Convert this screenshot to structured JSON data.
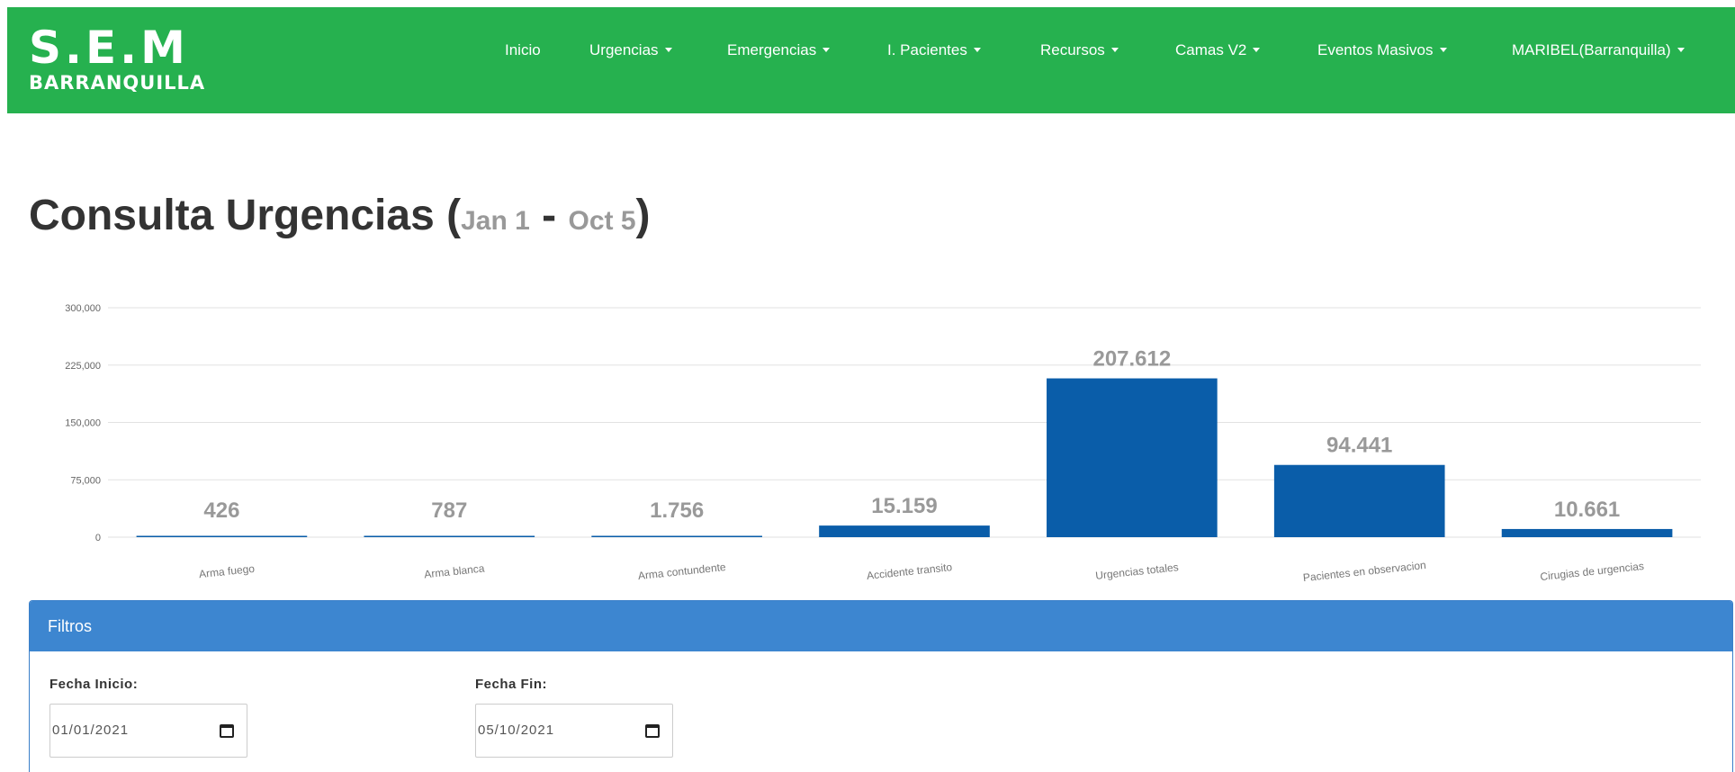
{
  "brand": {
    "line1": "S.E.M",
    "line2": "BARRANQUILLA"
  },
  "nav": {
    "items": [
      {
        "label": "Inicio",
        "dropdown": false
      },
      {
        "label": "Urgencias",
        "dropdown": true
      },
      {
        "label": "Emergencias",
        "dropdown": true
      },
      {
        "label": "I. Pacientes",
        "dropdown": true
      },
      {
        "label": "Recursos",
        "dropdown": true
      },
      {
        "label": "Camas V2",
        "dropdown": true
      },
      {
        "label": "Eventos Masivos",
        "dropdown": true
      },
      {
        "label": "MARIBEL(Barranquilla)",
        "dropdown": true
      }
    ]
  },
  "page": {
    "title": "Consulta Urgencias",
    "open_paren": "(",
    "range_start": "Jan 1",
    "range_sep": " - ",
    "range_end": "Oct 5",
    "close_paren": ")"
  },
  "chart_data": {
    "type": "bar",
    "categories": [
      "Arma fuego",
      "Arma blanca",
      "Arma contundente",
      "Accidente transito",
      "Urgencias totales",
      "Pacientes en observacion",
      "Cirugias de urgencias"
    ],
    "values": [
      426,
      787,
      1756,
      15159,
      207612,
      94441,
      10661
    ],
    "value_labels": [
      "426",
      "787",
      "1.756",
      "15.159",
      "207.612",
      "94.441",
      "10.661"
    ],
    "y_ticks": [
      0,
      75000,
      150000,
      225000,
      300000
    ],
    "y_tick_labels": [
      "0",
      "75,000",
      "150,000",
      "225,000",
      "300,000"
    ],
    "ylim": [
      0,
      300000
    ],
    "grid": true,
    "colors": {
      "bar": "#0a5da9",
      "grid": "#e2e2e2",
      "label": "#999999"
    }
  },
  "filters": {
    "heading": "Filtros",
    "start_label": "Fecha Inicio:",
    "start_value": "01/01/2021",
    "end_label": "Fecha Fin:",
    "end_value": "05/10/2021"
  },
  "colors": {
    "navbar": "#26b14f",
    "panel_heading": "#3d86d0"
  },
  "icons": {
    "date_picker": "calendar-icon",
    "dropdown": "caret-down-icon"
  }
}
